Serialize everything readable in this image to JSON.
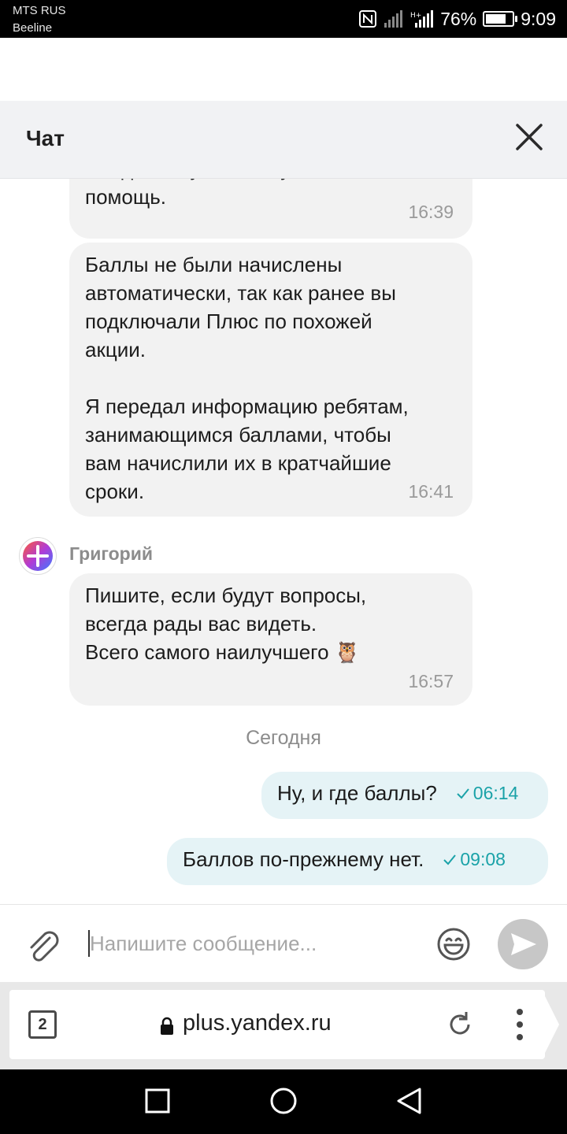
{
  "status_bar": {
    "carrier_primary": "MTS RUS",
    "carrier_secondary": "Beeline",
    "battery": "76%",
    "time": "9:09"
  },
  "chat": {
    "title": "Чат",
    "close_icon": "close-icon"
  },
  "messages": [
    {
      "text": "ожидание, уже спешу к вам на\nпомощь.",
      "time": "16:39"
    },
    {
      "text": "Баллы не были начислены\nавтоматически, так как ранее вы\nподключали Плюс по похожей\nакции.\n\nЯ передал информацию ребятам,\nзанимающимся баллами, чтобы\nвам начислили их в кратчайшие\nсроки.",
      "time": "16:41"
    },
    {
      "sender": "Григорий",
      "text": "Пишите, если будут вопросы,\nвсегда рады вас видеть.\nВсего самого наилучшего 🦉",
      "time": "16:57"
    }
  ],
  "date_separator": "Сегодня",
  "outgoing": [
    {
      "text": "Ну, и где баллы?",
      "time": "06:14"
    },
    {
      "text": "Баллов по-прежнему нет.",
      "time": "09:08"
    }
  ],
  "composer": {
    "placeholder": "Напишите сообщение..."
  },
  "browser": {
    "tabs_count": "2",
    "url": "plus.yandex.ru"
  },
  "colors": {
    "incoming_bubble": "#f2f2f2",
    "outgoing_bubble": "#e5f3f6",
    "read_check": "#1aa2a8",
    "header_bg": "#f1f2f4"
  }
}
